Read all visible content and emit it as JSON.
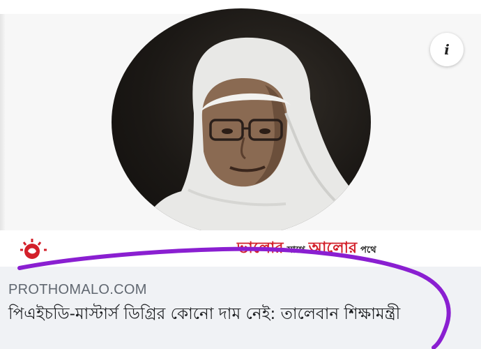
{
  "post_card": {
    "info_icon": "info-icon",
    "info_label": "i",
    "photo": "portrait-photo",
    "brand": {
      "logo": "prothomalo-logo",
      "slogan_word1": "ভালোর",
      "slogan_word2": "সাথে",
      "slogan_word3": "আলোর",
      "slogan_word4": "পথে",
      "slogan_color": "#d3202a"
    },
    "link": {
      "domain": "PROTHOMALO.COM",
      "headline": "পিএইচডি-মাস্টার্স ডিগ্রির কোনো দাম নেই: তালেবান শিক্ষামন্ত্রী"
    },
    "annotation_color": "#8a1fd1"
  }
}
